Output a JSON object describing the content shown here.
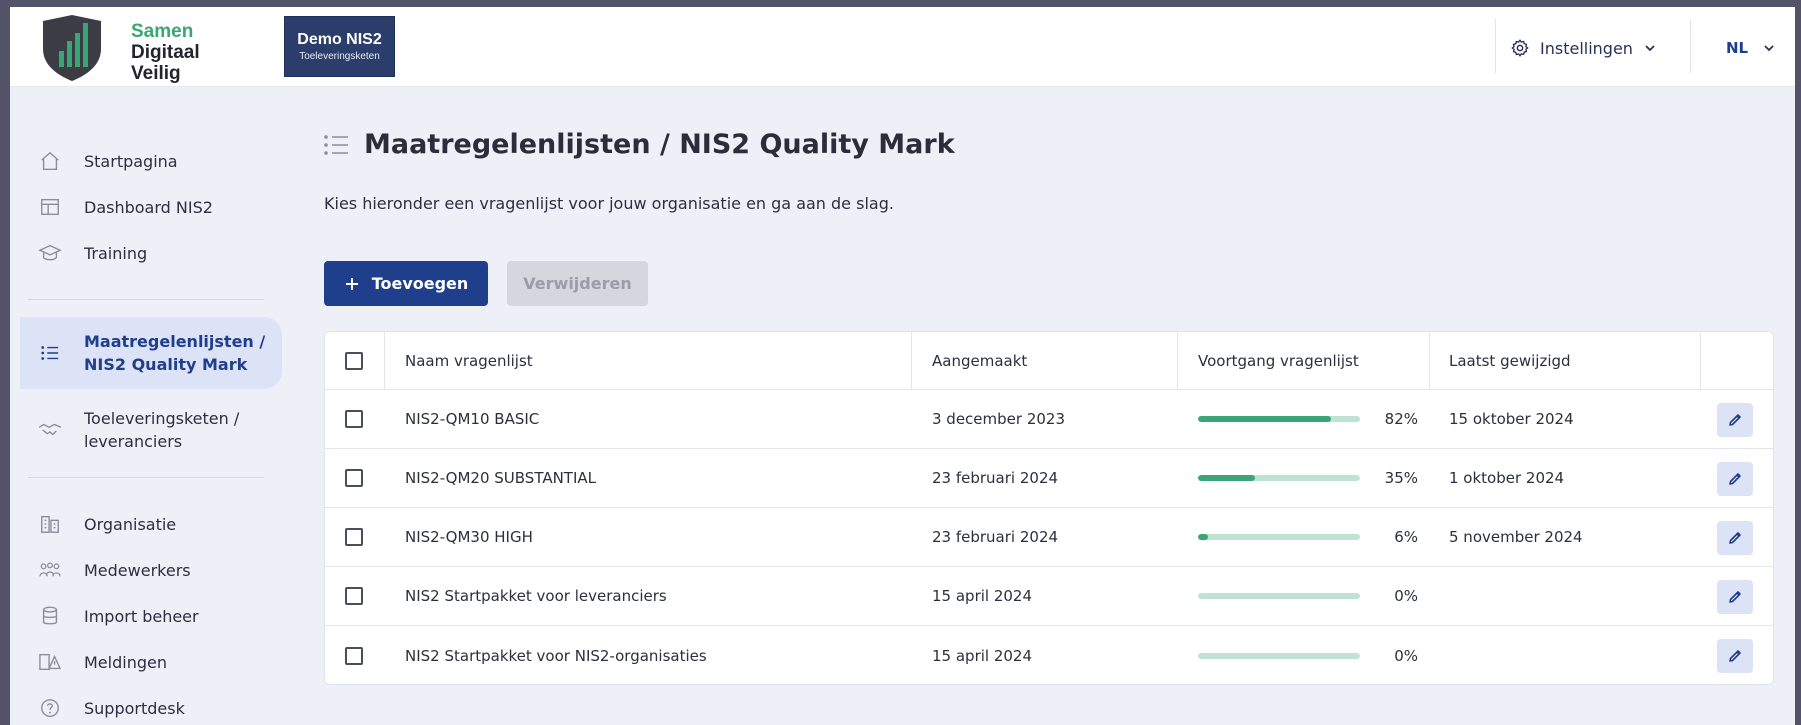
{
  "brand": {
    "logo_lines": [
      "Samen",
      "Digitaal",
      "Veilig"
    ],
    "demo_title": "Demo NIS2",
    "demo_subtitle": "Toeleveringsketen",
    "accent": "#3aa675",
    "primary": "#1f3e8c"
  },
  "header": {
    "settings_label": "Instellingen",
    "language": "NL"
  },
  "sidebar": {
    "group1": [
      {
        "label": "Startpagina",
        "icon": "home-icon"
      },
      {
        "label": "Dashboard NIS2",
        "icon": "layout-icon"
      },
      {
        "label": "Training",
        "icon": "graduation-cap-icon"
      }
    ],
    "group2": [
      {
        "label": "Maatregelenlijsten / NIS2 Quality Mark",
        "line1": "Maatregelenlijsten /",
        "line2": "NIS2 Quality Mark",
        "icon": "list-icon",
        "active": true
      },
      {
        "label": "Toeleveringsketen / leveranciers",
        "line1": "Toeleveringsketen /",
        "line2": "leveranciers",
        "icon": "handshake-icon"
      }
    ],
    "group3": [
      {
        "label": "Organisatie",
        "icon": "building-icon"
      },
      {
        "label": "Medewerkers",
        "icon": "people-icon"
      },
      {
        "label": "Import beheer",
        "icon": "database-icon"
      },
      {
        "label": "Meldingen",
        "icon": "alert-icon"
      },
      {
        "label": "Supportdesk",
        "icon": "help-icon"
      }
    ]
  },
  "main": {
    "title": "Maatregelenlijsten / NIS2 Quality Mark",
    "subtitle": "Kies hieronder een vragenlijst voor jouw organisatie en ga aan de slag.",
    "add_button": "Toevoegen",
    "delete_button": "Verwijderen",
    "table": {
      "columns": [
        "Naam vragenlijst",
        "Aangemaakt",
        "Voortgang vragenlijst",
        "Laatst gewijzigd"
      ],
      "rows": [
        {
          "name": "NIS2-QM10 BASIC",
          "created": "3 december 2023",
          "progress": 82,
          "progress_label": "82%",
          "modified": "15 oktober 2024"
        },
        {
          "name": "NIS2-QM20 SUBSTANTIAL",
          "created": "23 februari 2024",
          "progress": 35,
          "progress_label": "35%",
          "modified": "1 oktober 2024"
        },
        {
          "name": "NIS2-QM30 HIGH",
          "created": "23 februari 2024",
          "progress": 6,
          "progress_label": "6%",
          "modified": "5 november 2024"
        },
        {
          "name": "NIS2 Startpakket voor leveranciers",
          "created": "15 april 2024",
          "progress": 0,
          "progress_label": "0%",
          "modified": ""
        },
        {
          "name": "NIS2 Startpakket voor NIS2-organisaties",
          "created": "15 april 2024",
          "progress": 0,
          "progress_label": "0%",
          "modified": ""
        }
      ]
    }
  }
}
